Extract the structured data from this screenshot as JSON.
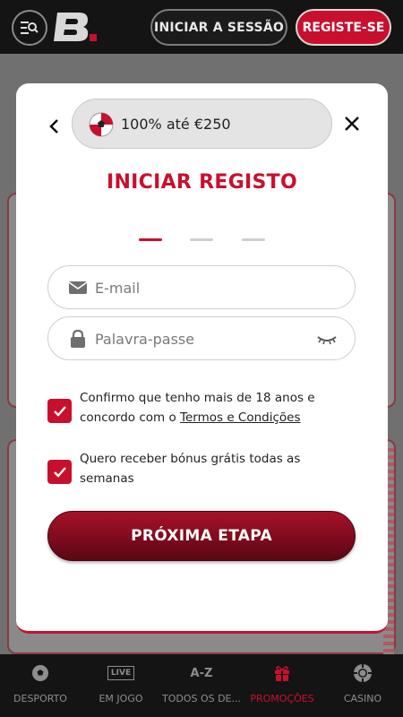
{
  "header": {
    "login_label": "INICIAR A SESSÃO",
    "register_label": "REGISTE-SE"
  },
  "modal": {
    "promo_text": "100% até €250",
    "title": "INICIAR REGISTO",
    "email_placeholder": "E-mail",
    "password_placeholder": "Palavra-passe",
    "age_consent_prefix": "Confirmo que tenho mais de 18 anos e concordo com o ",
    "terms_link": "Termos e Condições",
    "bonus_consent": "Quero receber bónus grátis todas as semanas",
    "next_button": "PRÓXIMA ETAPA",
    "current_step": 1,
    "total_steps": 3
  },
  "bottom_nav": {
    "items": [
      {
        "label": "DESPORTO",
        "icon": "soccer-ball-icon",
        "active": false
      },
      {
        "label": "EM JOGO",
        "icon": "live-icon",
        "icon_text": "LIVE",
        "active": false
      },
      {
        "label": "TODOS OS DE...",
        "icon": "a-z-icon",
        "icon_text": "A-Z",
        "active": false
      },
      {
        "label": "PROMOÇÕES",
        "icon": "gift-icon",
        "active": true
      },
      {
        "label": "CASINO",
        "icon": "casino-chip-icon",
        "active": false
      }
    ]
  },
  "colors": {
    "brand_red": "#c8102e",
    "header_bg": "#141414",
    "button_dark_red": "#5a0714"
  }
}
